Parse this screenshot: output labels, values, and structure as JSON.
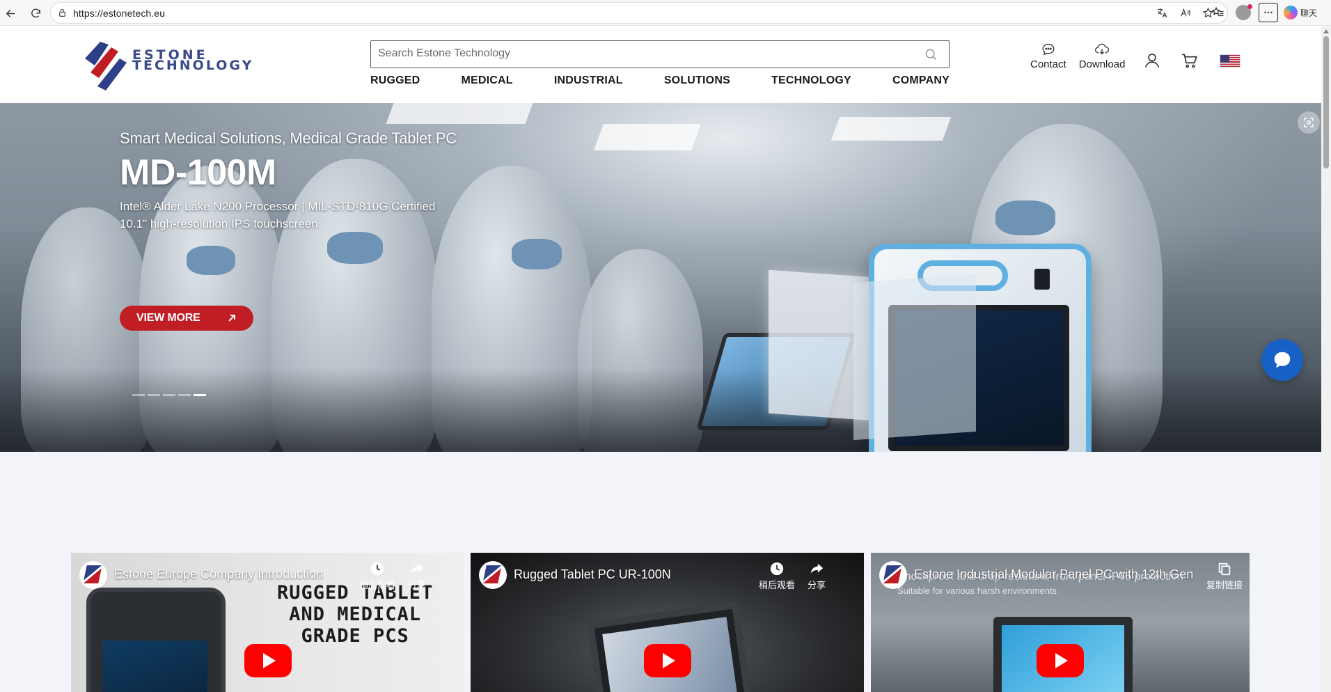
{
  "browser": {
    "url": "https://estonetech.eu",
    "copilot_label": "聊天"
  },
  "header": {
    "brand_line1": "ESTONE",
    "brand_line2": "TECHNOLOGY",
    "search_placeholder": "Search Estone Technology",
    "nav": [
      "RUGGED",
      "MEDICAL",
      "INDUSTRIAL",
      "SOLUTIONS",
      "TECHNOLOGY",
      "COMPANY"
    ],
    "contact_label": "Contact",
    "download_label": "Download"
  },
  "hero": {
    "subtitle": "Smart Medical Solutions, Medical Grade Tablet PC",
    "title": "MD-100M",
    "spec_line1": "Intel® Alder Lake N200 Processor | MIL-STD-810G Certified",
    "spec_line2": "10.1\" high-resolution IPS touchscreen",
    "cta_label": "VIEW MORE",
    "slide_count": 5,
    "active_slide": 5
  },
  "videos": [
    {
      "title": "Estone Europe Company Introduction",
      "thumb_text_line1": "RUGGED TABLET",
      "thumb_text_line2": "AND MEDICAL",
      "thumb_text_line3": "GRADE PCS",
      "watch_later": "稍后观看",
      "share": "分享"
    },
    {
      "title": "Rugged Tablet PC UR-100N",
      "watch_later": "稍后观看",
      "share": "分享"
    },
    {
      "title": "Estone Industrial Modular Panel PC with 12th Gen",
      "overlay_text": "Shockproof and drop-resistant, front panel IP65 protection",
      "overlay_sub": "Suitable for various harsh environments",
      "copy_link": "复制链接"
    }
  ],
  "colors": {
    "brand_blue": "#2d3f86",
    "brand_red": "#c01d25",
    "chat_blue": "#1760c5",
    "tablet_accent": "#5fb0e0"
  }
}
